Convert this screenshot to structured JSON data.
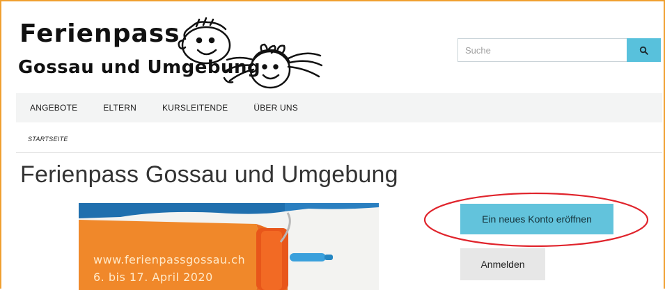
{
  "header": {
    "logo_line1": "Ferienpass",
    "logo_line2": "Gossau und Umgebung"
  },
  "search": {
    "placeholder": "Suche",
    "button_icon": "search-icon"
  },
  "nav": {
    "items": [
      {
        "label": "ANGEBOTE"
      },
      {
        "label": "ELTERN"
      },
      {
        "label": "KURSLEITENDE"
      },
      {
        "label": "ÜBER UNS"
      }
    ]
  },
  "breadcrumb": {
    "current": "STARTSEITE"
  },
  "main": {
    "title": "Ferienpass Gossau und Umgebung",
    "poster": {
      "url_text": "www.ferienpassgossau.ch",
      "date_text": "6. bis 17. April 2020"
    }
  },
  "actions": {
    "register_label": "Ein neues Konto eröffnen",
    "login_label": "Anmelden"
  },
  "colors": {
    "accent": "#58c1dc",
    "frame_border": "#f0a030",
    "annotation": "#e0242c",
    "poster_orange": "#f0882a"
  }
}
